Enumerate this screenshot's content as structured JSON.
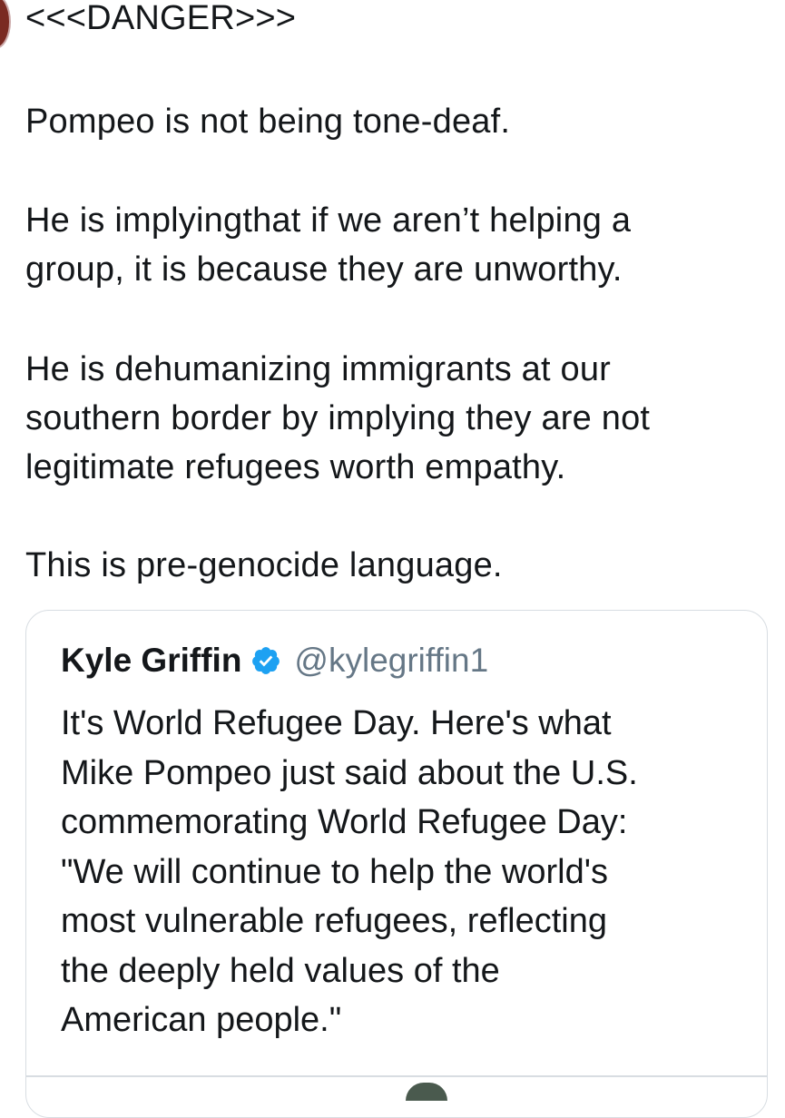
{
  "tweet": {
    "lines": [
      "<<<DANGER>>>",
      "Pompeo is not being tone-deaf.",
      "He is implyingthat if we aren’t helping a\ngroup, it is because they are unworthy.",
      "He is dehumanizing immigrants at our\nsouthern border by implying they are not\nlegitimate refugees worth empathy.",
      "This is pre-genocide language."
    ]
  },
  "quoted_tweet": {
    "author_name": "Kyle Griffin",
    "handle": "@kylegriffin1",
    "verified": true,
    "text": "It's World Refugee Day. Here's what\nMike Pompeo just said about the U.S.\ncommemorating World Refugee Day:\n\"We will continue to help the world's\nmost vulnerable refugees, reflecting\nthe deeply held values of the\nAmerican people.\""
  },
  "colors": {
    "text": "#14171a",
    "handle": "#657786",
    "verified_badge": "#1da1f2",
    "border": "#d8dde2"
  },
  "icons": [
    "verified-badge-icon"
  ]
}
